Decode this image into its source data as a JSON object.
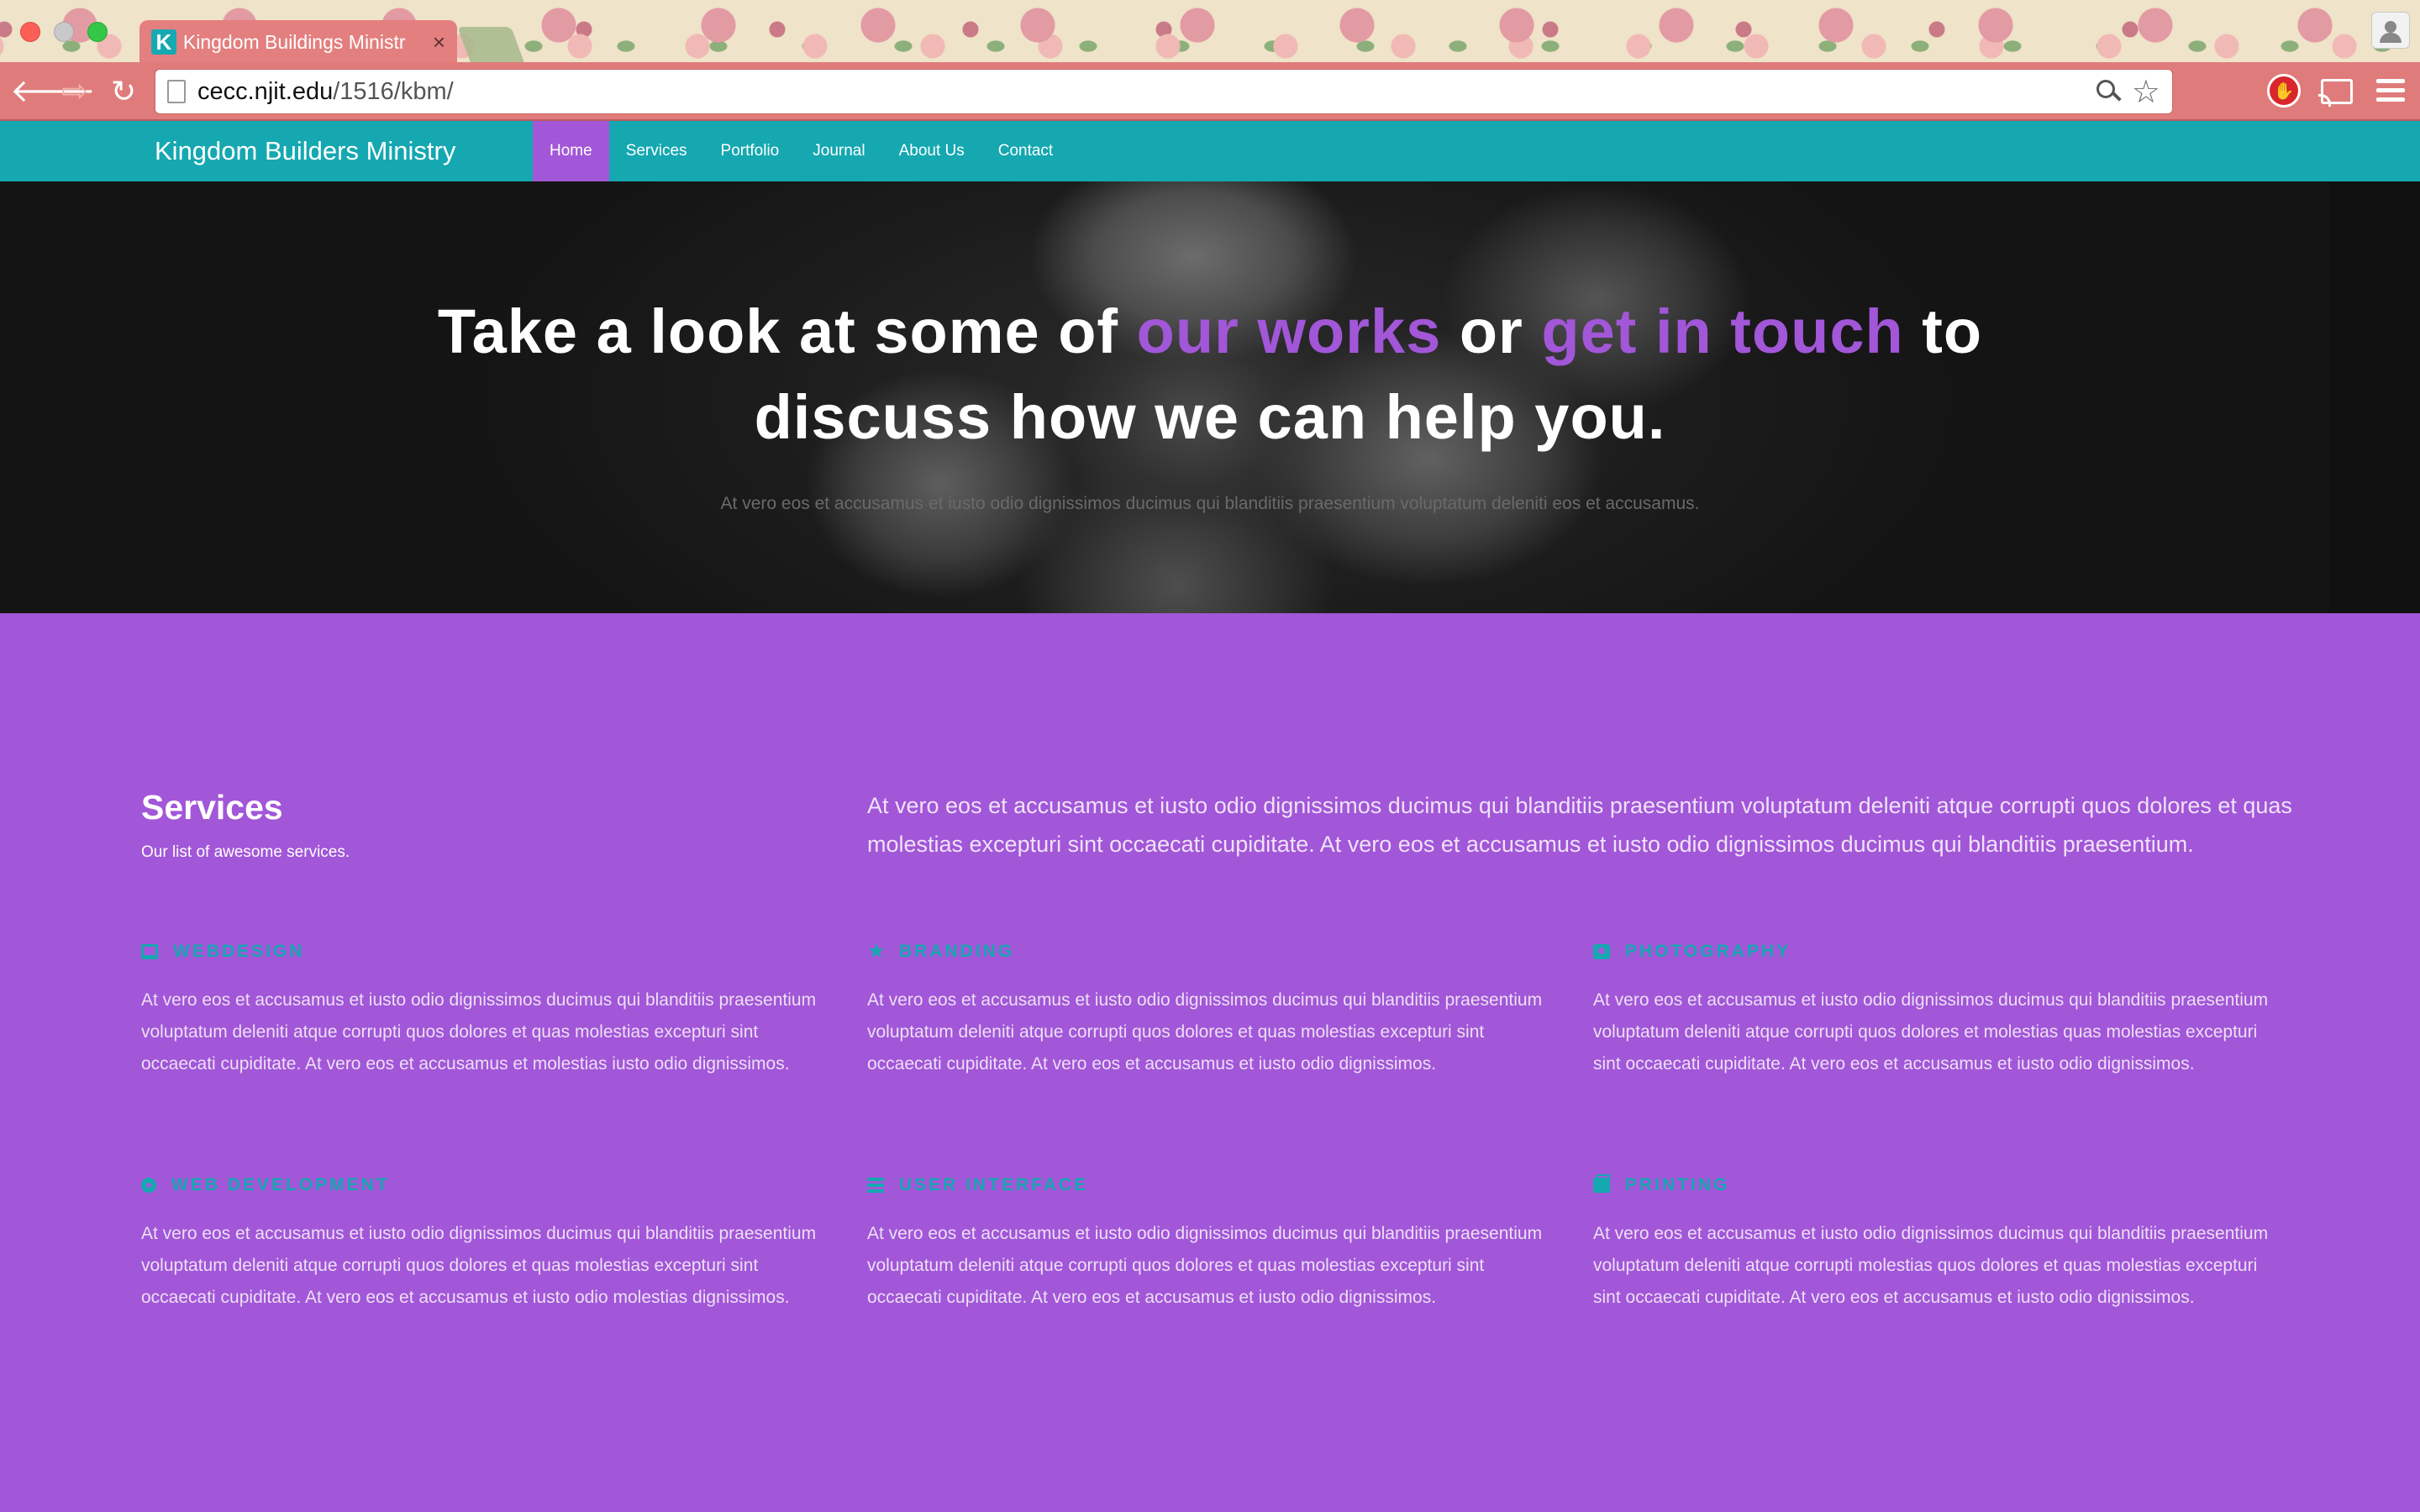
{
  "browser": {
    "tab_favicon": "K",
    "tab_title": "Kingdom Buildings Ministr",
    "tab_close": "×",
    "url_host": "cecc.njit.edu",
    "url_path": "/1516/kbm/",
    "icons": [
      "back-arrow-icon",
      "forward-arrow-icon",
      "reload-icon",
      "page-icon",
      "zoom-icon",
      "bookmark-star-icon",
      "adblock-icon",
      "cast-icon",
      "menu-icon",
      "profile-icon"
    ]
  },
  "nav": {
    "brand": "Kingdom Builders Ministry",
    "links": [
      {
        "label": "Home",
        "active": true
      },
      {
        "label": "Services",
        "active": false
      },
      {
        "label": "Portfolio",
        "active": false
      },
      {
        "label": "Journal",
        "active": false
      },
      {
        "label": "About Us",
        "active": false
      },
      {
        "label": "Contact",
        "active": false
      }
    ]
  },
  "hero": {
    "headline_part1": "Take a look at some of ",
    "headline_link1": "our works",
    "headline_part2": " or ",
    "headline_link2": "get in touch",
    "headline_part3": " to discuss how we can help you.",
    "subtitle": "At vero eos et accusamus et iusto odio dignissimos ducimus qui blanditiis praesentium voluptatum deleniti eos et accusamus."
  },
  "services": {
    "title": "Services",
    "subtitle": "Our list of awesome services.",
    "intro": "At vero eos et accusamus et iusto odio dignissimos ducimus qui blanditiis praesentium voluptatum deleniti atque corrupti quos dolores et quas molestias excepturi sint occaecati cupiditate. At vero eos et accusamus et iusto odio dignissimos ducimus qui blanditiis praesentium.",
    "items": [
      {
        "name": "WEBDESIGN",
        "icon": "laptop-icon",
        "text": "At vero eos et accusamus et iusto odio dignissimos ducimus qui blanditiis praesentium voluptatum deleniti atque corrupti quos dolores et quas molestias excepturi sint occaecati cupiditate. At vero eos et accusamus et molestias iusto odio dignissimos."
      },
      {
        "name": "BRANDING",
        "icon": "star-icon",
        "text": "At vero eos et accusamus et iusto odio dignissimos ducimus qui blanditiis praesentium voluptatum deleniti atque corrupti quos dolores et quas molestias excepturi sint occaecati cupiditate. At vero eos et accusamus et iusto odio dignissimos."
      },
      {
        "name": "PHOTOGRAPHY",
        "icon": "camera-icon",
        "text": "At vero eos et accusamus et iusto odio dignissimos ducimus qui blanditiis praesentium voluptatum deleniti atque corrupti quos dolores et molestias quas molestias excepturi sint occaecati cupiditate. At vero eos et accusamus et iusto odio dignissimos."
      },
      {
        "name": "WEB DEVELOPMENT",
        "icon": "cog-icon",
        "text": "At vero eos et accusamus et iusto odio dignissimos ducimus qui blanditiis praesentium voluptatum deleniti atque corrupti quos dolores et quas molestias excepturi sint occaecati cupiditate. At vero eos et accusamus et iusto odio molestias dignissimos."
      },
      {
        "name": "USER INTERFACE",
        "icon": "interface-icon",
        "text": "At vero eos et accusamus et iusto odio dignissimos ducimus qui blanditiis praesentium voluptatum deleniti atque corrupti quos dolores et quas molestias excepturi sint occaecati cupiditate. At vero eos et accusamus et iusto odio dignissimos."
      },
      {
        "name": "PRINTING",
        "icon": "printer-icon",
        "text": "At vero eos et accusamus et iusto odio dignissimos ducimus qui blanditiis praesentium voluptatum deleniti atque corrupti molestias quos dolores et quas molestias excepturi sint occaecati cupiditate. At vero eos et accusamus et iusto odio dignissimos."
      }
    ]
  },
  "colors": {
    "teal": "#15a8b1",
    "purple": "#a256d8",
    "chrome": "#df7c7b"
  }
}
